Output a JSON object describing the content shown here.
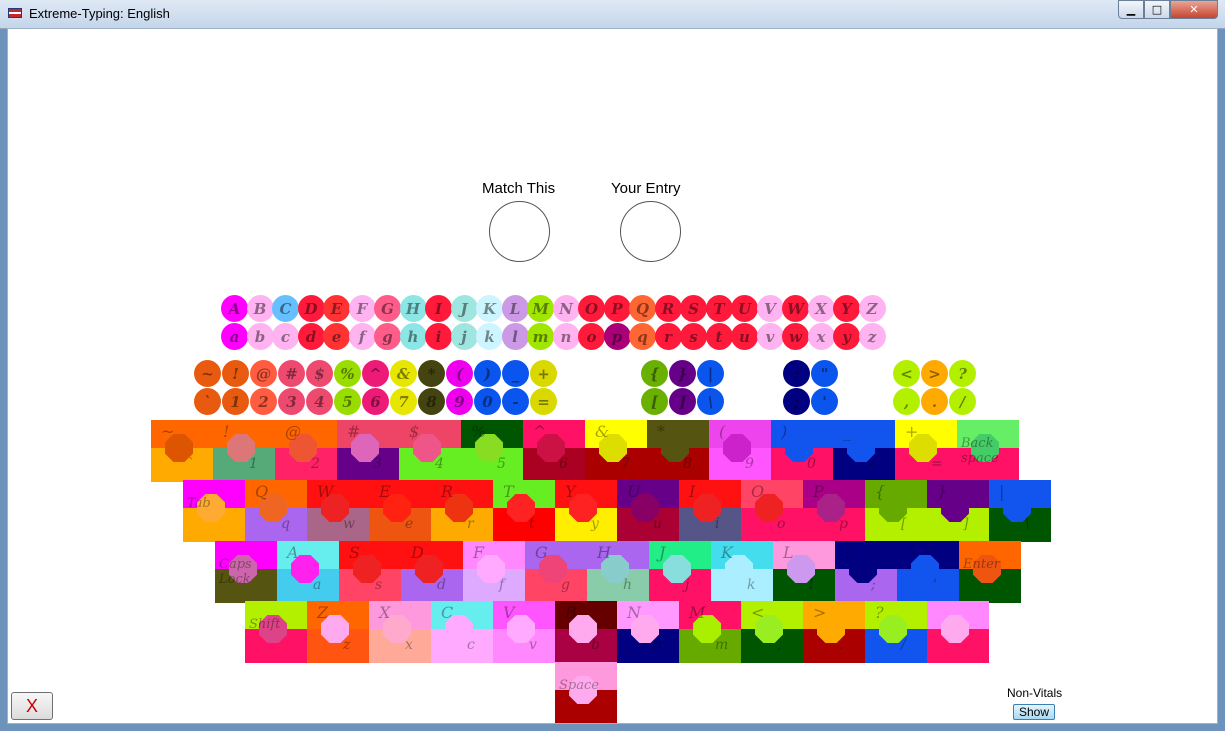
{
  "window": {
    "title": "Extreme-Typing: English",
    "minimize_glyph": "▁",
    "maximize_glyph": "□",
    "close_glyph": "✕"
  },
  "labels": {
    "match": "Match This",
    "entry": "Your Entry"
  },
  "upper_circles": [
    {
      "ch": "A",
      "color": "#ff00ff"
    },
    {
      "ch": "B",
      "color": "#ffb3f0"
    },
    {
      "ch": "C",
      "color": "#66c0ff"
    },
    {
      "ch": "D",
      "color": "#ff1a3c"
    },
    {
      "ch": "E",
      "color": "#ff3333"
    },
    {
      "ch": "F",
      "color": "#ffb3f0"
    },
    {
      "ch": "G",
      "color": "#ff5c8a"
    },
    {
      "ch": "H",
      "color": "#8ce6e6"
    },
    {
      "ch": "I",
      "color": "#ff1a3c"
    },
    {
      "ch": "J",
      "color": "#a0e6e0"
    },
    {
      "ch": "K",
      "color": "#ccf5ff"
    },
    {
      "ch": "L",
      "color": "#cc99e6"
    },
    {
      "ch": "M",
      "color": "#a0e600"
    },
    {
      "ch": "N",
      "color": "#ffb3f0"
    },
    {
      "ch": "O",
      "color": "#ff1a3c"
    },
    {
      "ch": "P",
      "color": "#ff1a3c"
    },
    {
      "ch": "Q",
      "color": "#ff6633"
    },
    {
      "ch": "R",
      "color": "#ff1a3c"
    },
    {
      "ch": "S",
      "color": "#ff1a3c"
    },
    {
      "ch": "T",
      "color": "#ff1a3c"
    },
    {
      "ch": "U",
      "color": "#ff1a3c"
    },
    {
      "ch": "V",
      "color": "#ffb3f0"
    },
    {
      "ch": "W",
      "color": "#ff1a3c"
    },
    {
      "ch": "X",
      "color": "#ffb3f0"
    },
    {
      "ch": "Y",
      "color": "#ff1a3c"
    },
    {
      "ch": "Z",
      "color": "#ffb3f0"
    }
  ],
  "lower_circles": [
    {
      "ch": "a",
      "color": "#ff00ff"
    },
    {
      "ch": "b",
      "color": "#ffb3f0"
    },
    {
      "ch": "c",
      "color": "#ffb3f0"
    },
    {
      "ch": "d",
      "color": "#ff1a3c"
    },
    {
      "ch": "e",
      "color": "#ff3333"
    },
    {
      "ch": "f",
      "color": "#ffb3f0"
    },
    {
      "ch": "g",
      "color": "#ff5c8a"
    },
    {
      "ch": "h",
      "color": "#8ce6e6"
    },
    {
      "ch": "i",
      "color": "#ff1a3c"
    },
    {
      "ch": "j",
      "color": "#a0e6e0"
    },
    {
      "ch": "k",
      "color": "#ccf5ff"
    },
    {
      "ch": "l",
      "color": "#cc99e6"
    },
    {
      "ch": "m",
      "color": "#a0e600"
    },
    {
      "ch": "n",
      "color": "#ffb3f0"
    },
    {
      "ch": "o",
      "color": "#ff1a3c"
    },
    {
      "ch": "p",
      "color": "#aa0077"
    },
    {
      "ch": "q",
      "color": "#ff6633"
    },
    {
      "ch": "r",
      "color": "#ff1a3c"
    },
    {
      "ch": "s",
      "color": "#ff1a3c"
    },
    {
      "ch": "t",
      "color": "#ff1a3c"
    },
    {
      "ch": "u",
      "color": "#ff1a3c"
    },
    {
      "ch": "v",
      "color": "#ffb3f0"
    },
    {
      "ch": "w",
      "color": "#ff1a3c"
    },
    {
      "ch": "x",
      "color": "#ffb3f0"
    },
    {
      "ch": "y",
      "color": "#ff1a3c"
    },
    {
      "ch": "z",
      "color": "#ffb3f0"
    }
  ],
  "symbol_circles": [
    {
      "group": "num",
      "top": "~",
      "bottom": "`",
      "color": "#e85a10"
    },
    {
      "group": "num",
      "top": "!",
      "bottom": "1",
      "color": "#e85a10"
    },
    {
      "group": "num",
      "top": "@",
      "bottom": "2",
      "color": "#ff5c40"
    },
    {
      "group": "num",
      "top": "#",
      "bottom": "3",
      "color": "#ee4a70"
    },
    {
      "group": "num",
      "top": "$",
      "bottom": "4",
      "color": "#ee4a70"
    },
    {
      "group": "num",
      "top": "%",
      "bottom": "5",
      "color": "#99dd00"
    },
    {
      "group": "num",
      "top": "^",
      "bottom": "6",
      "color": "#ee1a77"
    },
    {
      "group": "num",
      "top": "&",
      "bottom": "7",
      "color": "#e6e600"
    },
    {
      "group": "num",
      "top": "*",
      "bottom": "8",
      "color": "#444411"
    },
    {
      "group": "num",
      "top": "(",
      "bottom": "9",
      "color": "#ee00ee"
    },
    {
      "group": "num",
      "top": ")",
      "bottom": "0",
      "color": "#0a55ee"
    },
    {
      "group": "num",
      "top": "_",
      "bottom": "-",
      "color": "#0a55ee"
    },
    {
      "group": "num",
      "top": "+",
      "bottom": "=",
      "color": "#d9d900"
    },
    {
      "group": "brk",
      "top": "{",
      "bottom": "[",
      "color": "#6ab000"
    },
    {
      "group": "brk",
      "top": "}",
      "bottom": "]",
      "color": "#660088"
    },
    {
      "group": "brk",
      "top": "|",
      "bottom": "\\",
      "color": "#0a55ee"
    },
    {
      "group": "punc",
      "top": ":",
      "bottom": ";",
      "color": "#000080"
    },
    {
      "group": "punc",
      "top": "\"",
      "bottom": "'",
      "color": "#0a55ee"
    },
    {
      "group": "ang",
      "top": "<",
      "bottom": ",",
      "color": "#b3f000"
    },
    {
      "group": "ang",
      "top": ">",
      "bottom": ".",
      "color": "#ffaa00"
    },
    {
      "group": "ang",
      "top": "?",
      "bottom": "/",
      "color": "#b3f000"
    }
  ],
  "keyboard": {
    "row1": [
      {
        "top": "~",
        "bottom": "`",
        "c1": "#ff6600",
        "c2": "#ffaa00",
        "oc": "#dd5500"
      },
      {
        "top": "!",
        "bottom": "1",
        "c1": "#ff6600",
        "c2": "#55aa77",
        "oc": "#dd7777"
      },
      {
        "top": "@",
        "bottom": "2",
        "c1": "#ff6600",
        "c2": "#ff2266",
        "oc": "#ee5533"
      },
      {
        "top": "#",
        "bottom": "3",
        "c1": "#ee4466",
        "c2": "#660088",
        "oc": "#dd66bb"
      },
      {
        "top": "$",
        "bottom": "4",
        "c1": "#ee4466",
        "c2": "#66ee22",
        "oc": "#ee5588"
      },
      {
        "top": "%",
        "bottom": "5",
        "c1": "#005500",
        "c2": "#66ee22",
        "oc": "#88dd22"
      },
      {
        "top": "^",
        "bottom": "6",
        "c1": "#ff1166",
        "c2": "#aa0022",
        "oc": "#cc1144"
      },
      {
        "top": "&",
        "bottom": "7",
        "c1": "#ffff00",
        "c2": "#aa0000",
        "oc": "#dddd00"
      },
      {
        "top": "*",
        "bottom": "8",
        "c1": "#555511",
        "c2": "#aa0000",
        "oc": "#555511"
      },
      {
        "top": "(",
        "bottom": "9",
        "c1": "#ee44ee",
        "c2": "#ff55ff",
        "oc": "#cc22cc"
      },
      {
        "top": ")",
        "bottom": "0",
        "c1": "#1155ee",
        "c2": "#ff1166",
        "oc": "#1155ee"
      },
      {
        "top": "_",
        "bottom": "-",
        "c1": "#1155ee",
        "c2": "#000080",
        "oc": "#1155ee"
      },
      {
        "top": "+",
        "bottom": "=",
        "c1": "#ffff00",
        "c2": "#ff1166",
        "oc": "#dddd00"
      },
      {
        "top": "Back space",
        "bottom": "",
        "c1": "#66ee66",
        "c2": "#ff1166",
        "oc": "#44cc66",
        "word": true
      }
    ],
    "row2": [
      {
        "top": "Tab",
        "bottom": "",
        "c1": "#ff00ff",
        "c2": "#ffaa00",
        "oc": "#ffaa33",
        "word": true
      },
      {
        "top": "Q",
        "bottom": "q",
        "c1": "#ff6600",
        "c2": "#aa66ee",
        "oc": "#ee6622"
      },
      {
        "top": "W",
        "bottom": "w",
        "c1": "#ff1111",
        "c2": "#aa6688",
        "oc": "#ee2222"
      },
      {
        "top": "E",
        "bottom": "e",
        "c1": "#ff1111",
        "c2": "#ee5511",
        "oc": "#ff2211"
      },
      {
        "top": "R",
        "bottom": "r",
        "c1": "#ff1111",
        "c2": "#ffaa00",
        "oc": "#ee3311"
      },
      {
        "top": "T",
        "bottom": "t",
        "c1": "#66ee22",
        "c2": "#ff0000",
        "oc": "#ff2222"
      },
      {
        "top": "Y",
        "bottom": "y",
        "c1": "#ff1111",
        "c2": "#ffee00",
        "oc": "#ff2222"
      },
      {
        "top": "U",
        "bottom": "u",
        "c1": "#660088",
        "c2": "#aa0033",
        "oc": "#880066"
      },
      {
        "top": "I",
        "bottom": "i",
        "c1": "#ff1111",
        "c2": "#555588",
        "oc": "#ee2222"
      },
      {
        "top": "O",
        "bottom": "o",
        "c1": "#ff4466",
        "c2": "#ff1166",
        "oc": "#ee2222"
      },
      {
        "top": "P",
        "bottom": "p",
        "c1": "#aa0088",
        "c2": "#ff1166",
        "oc": "#aa2288"
      },
      {
        "top": "{",
        "bottom": "[",
        "c1": "#66aa00",
        "c2": "#b3f000",
        "oc": "#66aa00"
      },
      {
        "top": "}",
        "bottom": "]",
        "c1": "#660088",
        "c2": "#b3f000",
        "oc": "#660088"
      },
      {
        "top": "|",
        "bottom": "\\",
        "c1": "#1155ee",
        "c2": "#005500",
        "oc": "#1155ee"
      }
    ],
    "row3": [
      {
        "top": "Caps Lock",
        "bottom": "",
        "c1": "#ff00ff",
        "c2": "#555511",
        "oc": "#cc66aa",
        "word": true
      },
      {
        "top": "A",
        "bottom": "a",
        "c1": "#66eeee",
        "c2": "#44ccee",
        "oc": "#ff22ee"
      },
      {
        "top": "S",
        "bottom": "s",
        "c1": "#ff1111",
        "c2": "#ff4466",
        "oc": "#ee2222"
      },
      {
        "top": "D",
        "bottom": "d",
        "c1": "#ff1111",
        "c2": "#aa66ee",
        "oc": "#ee2222"
      },
      {
        "top": "F",
        "bottom": "f",
        "c1": "#ff88ff",
        "c2": "#ddaaff",
        "oc": "#ffaaff"
      },
      {
        "top": "G",
        "bottom": "g",
        "c1": "#aa66ee",
        "c2": "#ff4466",
        "oc": "#ee4477"
      },
      {
        "top": "H",
        "bottom": "h",
        "c1": "#aa66ee",
        "c2": "#88ccaa",
        "oc": "#88cccc"
      },
      {
        "top": "J",
        "bottom": "j",
        "c1": "#22ee88",
        "c2": "#ff1166",
        "oc": "#88dddd"
      },
      {
        "top": "K",
        "bottom": "k",
        "c1": "#44ddee",
        "c2": "#aaeeff",
        "oc": "#aaeeff"
      },
      {
        "top": "L",
        "bottom": "l",
        "c1": "#ff99dd",
        "c2": "#005500",
        "oc": "#cc99ee"
      },
      {
        "top": ":",
        "bottom": ";",
        "c1": "#000080",
        "c2": "#aa66ee",
        "oc": "#000080"
      },
      {
        "top": "\"",
        "bottom": "'",
        "c1": "#000080",
        "c2": "#1155ee",
        "oc": "#1155ee"
      },
      {
        "top": "Enter",
        "bottom": "",
        "c1": "#ff6600",
        "c2": "#005500",
        "oc": "#ee5511",
        "word": true
      }
    ],
    "row4": [
      {
        "top": "Shift",
        "bottom": "",
        "c1": "#b3f000",
        "c2": "#ff1166",
        "oc": "#dd4488",
        "word": true
      },
      {
        "top": "Z",
        "bottom": "z",
        "c1": "#ff6600",
        "c2": "#ff5511",
        "oc": "#ffaaee"
      },
      {
        "top": "X",
        "bottom": "x",
        "c1": "#ff99dd",
        "c2": "#ffaa99",
        "oc": "#ffaacc"
      },
      {
        "top": "C",
        "bottom": "c",
        "c1": "#66eeee",
        "c2": "#ffaaff",
        "oc": "#ffaaff"
      },
      {
        "top": "V",
        "bottom": "v",
        "c1": "#ff55ff",
        "c2": "#ff88ff",
        "oc": "#ffaaff"
      },
      {
        "top": "B",
        "bottom": "b",
        "c1": "#660000",
        "c2": "#aa0044",
        "oc": "#ffaaee"
      },
      {
        "top": "N",
        "bottom": "n",
        "c1": "#ff99ff",
        "c2": "#000080",
        "oc": "#ffaaee"
      },
      {
        "top": "M",
        "bottom": "m",
        "c1": "#ff1166",
        "c2": "#66aa00",
        "oc": "#aaee00"
      },
      {
        "top": "<",
        "bottom": ",",
        "c1": "#b3f000",
        "c2": "#005500",
        "oc": "#99ee22"
      },
      {
        "top": ">",
        "bottom": ".",
        "c1": "#ffaa00",
        "c2": "#aa0000",
        "oc": "#ffaa00"
      },
      {
        "top": "?",
        "bottom": "/",
        "c1": "#b3f000",
        "c2": "#1155ee",
        "oc": "#99ee22"
      },
      {
        "top": "",
        "bottom": "",
        "c1": "#ff88ff",
        "c2": "#ff1166",
        "oc": "#ffaaee"
      }
    ],
    "row5": [
      {
        "top": "Space",
        "bottom": "",
        "c1": "#ff99dd",
        "c2": "#aa0000",
        "oc": "#ffaaee",
        "word": true
      }
    ]
  },
  "footer": {
    "close_label": "X",
    "nonvitals_label": "Non-Vitals",
    "show_label": "Show"
  }
}
